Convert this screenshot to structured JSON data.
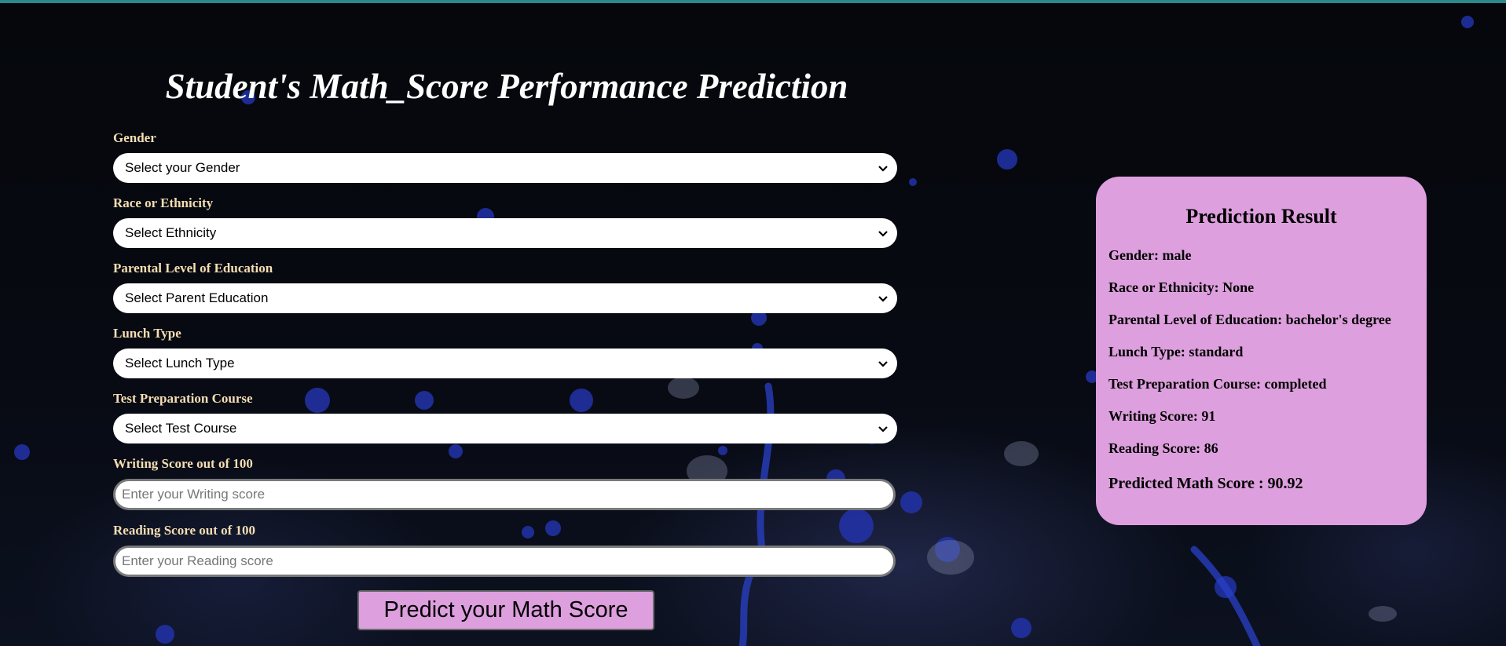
{
  "page": {
    "title": "Student's Math_Score Performance Prediction"
  },
  "form": {
    "gender": {
      "label": "Gender",
      "selected": "Select your Gender"
    },
    "ethnicity": {
      "label": "Race or Ethnicity",
      "selected": "Select Ethnicity"
    },
    "parental_education": {
      "label": "Parental Level of Education",
      "selected": "Select Parent Education"
    },
    "lunch": {
      "label": "Lunch Type",
      "selected": "Select Lunch Type"
    },
    "test_course": {
      "label": "Test Preparation Course",
      "selected": "Select Test Course"
    },
    "writing_score": {
      "label": "Writing Score out of 100",
      "placeholder": "Enter your Writing score",
      "value": ""
    },
    "reading_score": {
      "label": "Reading Score out of 100",
      "placeholder": "Enter your Reading score",
      "value": ""
    },
    "submit_label": "Predict your Math Score"
  },
  "result": {
    "title": "Prediction Result",
    "lines": [
      "Gender: male",
      "Race or Ethnicity: None",
      "Parental Level of Education: bachelor's degree",
      "Lunch Type: standard",
      "Test Preparation Course: completed",
      "Writing Score: 91",
      "Reading Score: 86"
    ],
    "predicted": "Predicted Math Score : 90.92"
  },
  "colors": {
    "top_bar": "#2a8a8a",
    "label_text": "#f5deb3",
    "accent": "#dd9fdd",
    "background": "#05070b"
  }
}
